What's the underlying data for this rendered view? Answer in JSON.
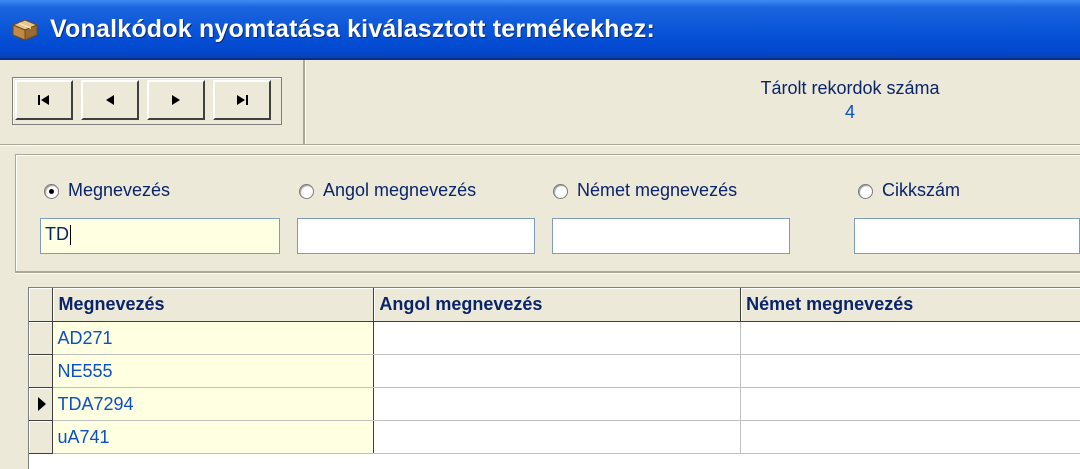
{
  "window": {
    "title": "Vonalkódok nyomtatása kiválasztott termékekhez:",
    "icon": "box-icon"
  },
  "navigator": {
    "buttons": [
      {
        "name": "first-record-button",
        "icon": "first-icon"
      },
      {
        "name": "prev-record-button",
        "icon": "prev-icon"
      },
      {
        "name": "next-record-button",
        "icon": "next-icon"
      },
      {
        "name": "last-record-button",
        "icon": "last-icon"
      }
    ]
  },
  "record_count": {
    "label": "Tárolt rekordok száma",
    "value": "4"
  },
  "search": {
    "options": [
      {
        "label": "Megnevezés",
        "checked": true,
        "value": "TD"
      },
      {
        "label": "Angol megnevezés",
        "checked": false,
        "value": ""
      },
      {
        "label": "Német megnevezés",
        "checked": false,
        "value": ""
      },
      {
        "label": "Cikkszám",
        "checked": false,
        "value": ""
      }
    ]
  },
  "table": {
    "columns": [
      "Megnevezés",
      "Angol megnevezés",
      "Német megnevezés"
    ],
    "rows": [
      {
        "megnevezes": "AD271",
        "angol": "",
        "nemet": "",
        "current": false
      },
      {
        "megnevezes": "NE555",
        "angol": "",
        "nemet": "",
        "current": false
      },
      {
        "megnevezes": "TDA7294",
        "angol": "",
        "nemet": "",
        "current": true
      },
      {
        "megnevezes": "uA741",
        "angol": "",
        "nemet": "",
        "current": false
      }
    ]
  },
  "colors": {
    "title_bar": "#0a55d8",
    "text_label": "#0a246a",
    "text_value": "#0a50c8",
    "highlight_cell": "#ffffe1"
  }
}
